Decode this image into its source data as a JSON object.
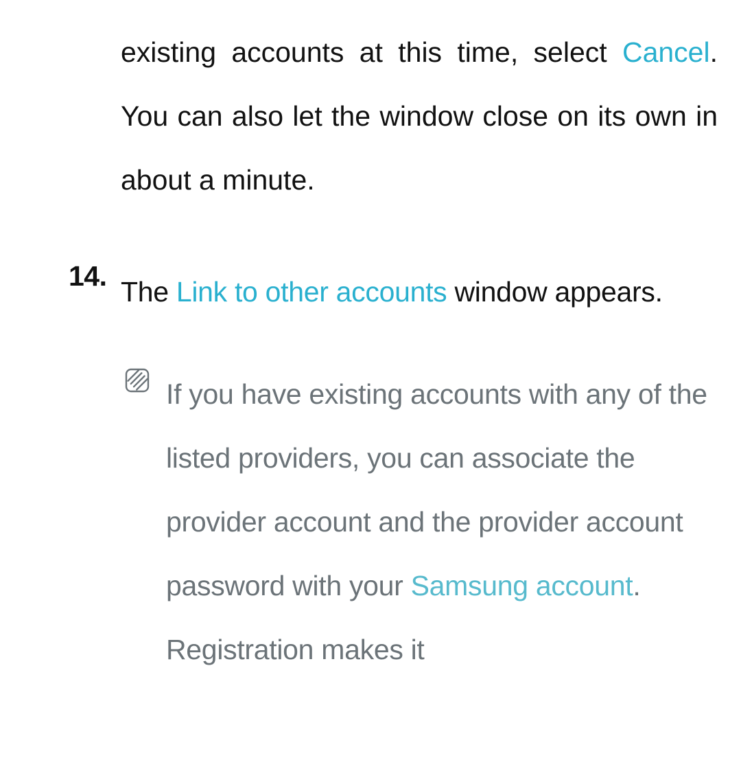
{
  "para13": {
    "t1": "existing accounts at this time, select ",
    "link": "Cancel",
    "t2": ". You can also let the window close on its own in about a minute."
  },
  "step14": {
    "number": "14.",
    "t1": "The ",
    "link": "Link to other accounts",
    "t2": " window appears."
  },
  "note": {
    "t1": "If you have existing accounts with any of the listed providers, you can associate the provider account and the provider account password with your ",
    "link": "Samsung account",
    "t2": ". Registration makes it"
  },
  "icon_name": "note-icon"
}
